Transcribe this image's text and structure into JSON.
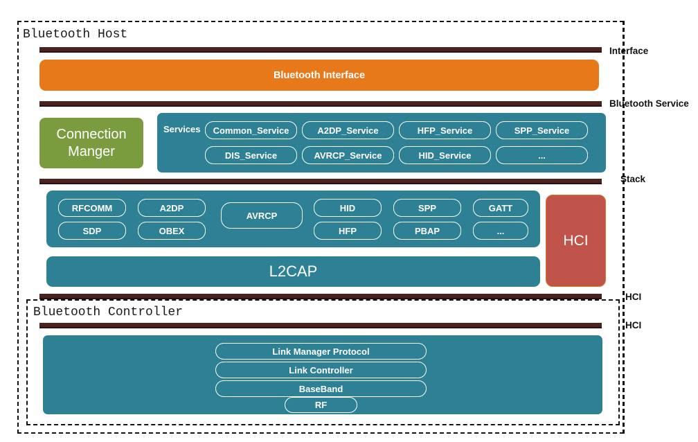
{
  "diagram": {
    "host_box_title": "Bluetooth Host",
    "controller_box_title": "Bluetooth Controller"
  },
  "side_labels": {
    "interface": "Interface",
    "bluetooth_service": "Bluetooth Service",
    "stack": "Stack",
    "hci_upper": "HCI",
    "hci_lower": "HCI"
  },
  "interface_layer": {
    "label": "Bluetooth Interface",
    "color": "#e8791a"
  },
  "connection_manager": {
    "line1": "Connection",
    "line2": "Manger",
    "color": "#7b9b3f"
  },
  "services_layer": {
    "label": "Services",
    "color": "#2e8195",
    "row1": [
      "Common_Service",
      "A2DP_Service",
      "HFP_Service",
      "SPP_Service"
    ],
    "row2": [
      "DIS_Service",
      "AVRCP_Service",
      "HID_Service",
      "..."
    ]
  },
  "stack_layer": {
    "color": "#2e8195",
    "row1": [
      "RFCOMM",
      "A2DP",
      "HID",
      "SPP",
      "GATT"
    ],
    "row2": [
      "SDP",
      "OBEX",
      "HFP",
      "PBAP",
      "..."
    ],
    "tall": "AVRCP",
    "l2cap": "L2CAP"
  },
  "hci_block": {
    "label": "HCI",
    "color": "#c0544a"
  },
  "controller_layer": {
    "color": "#2e8195",
    "items": [
      "Link Manager Protocol",
      "Link Controller",
      "BaseBand",
      "RF"
    ]
  }
}
